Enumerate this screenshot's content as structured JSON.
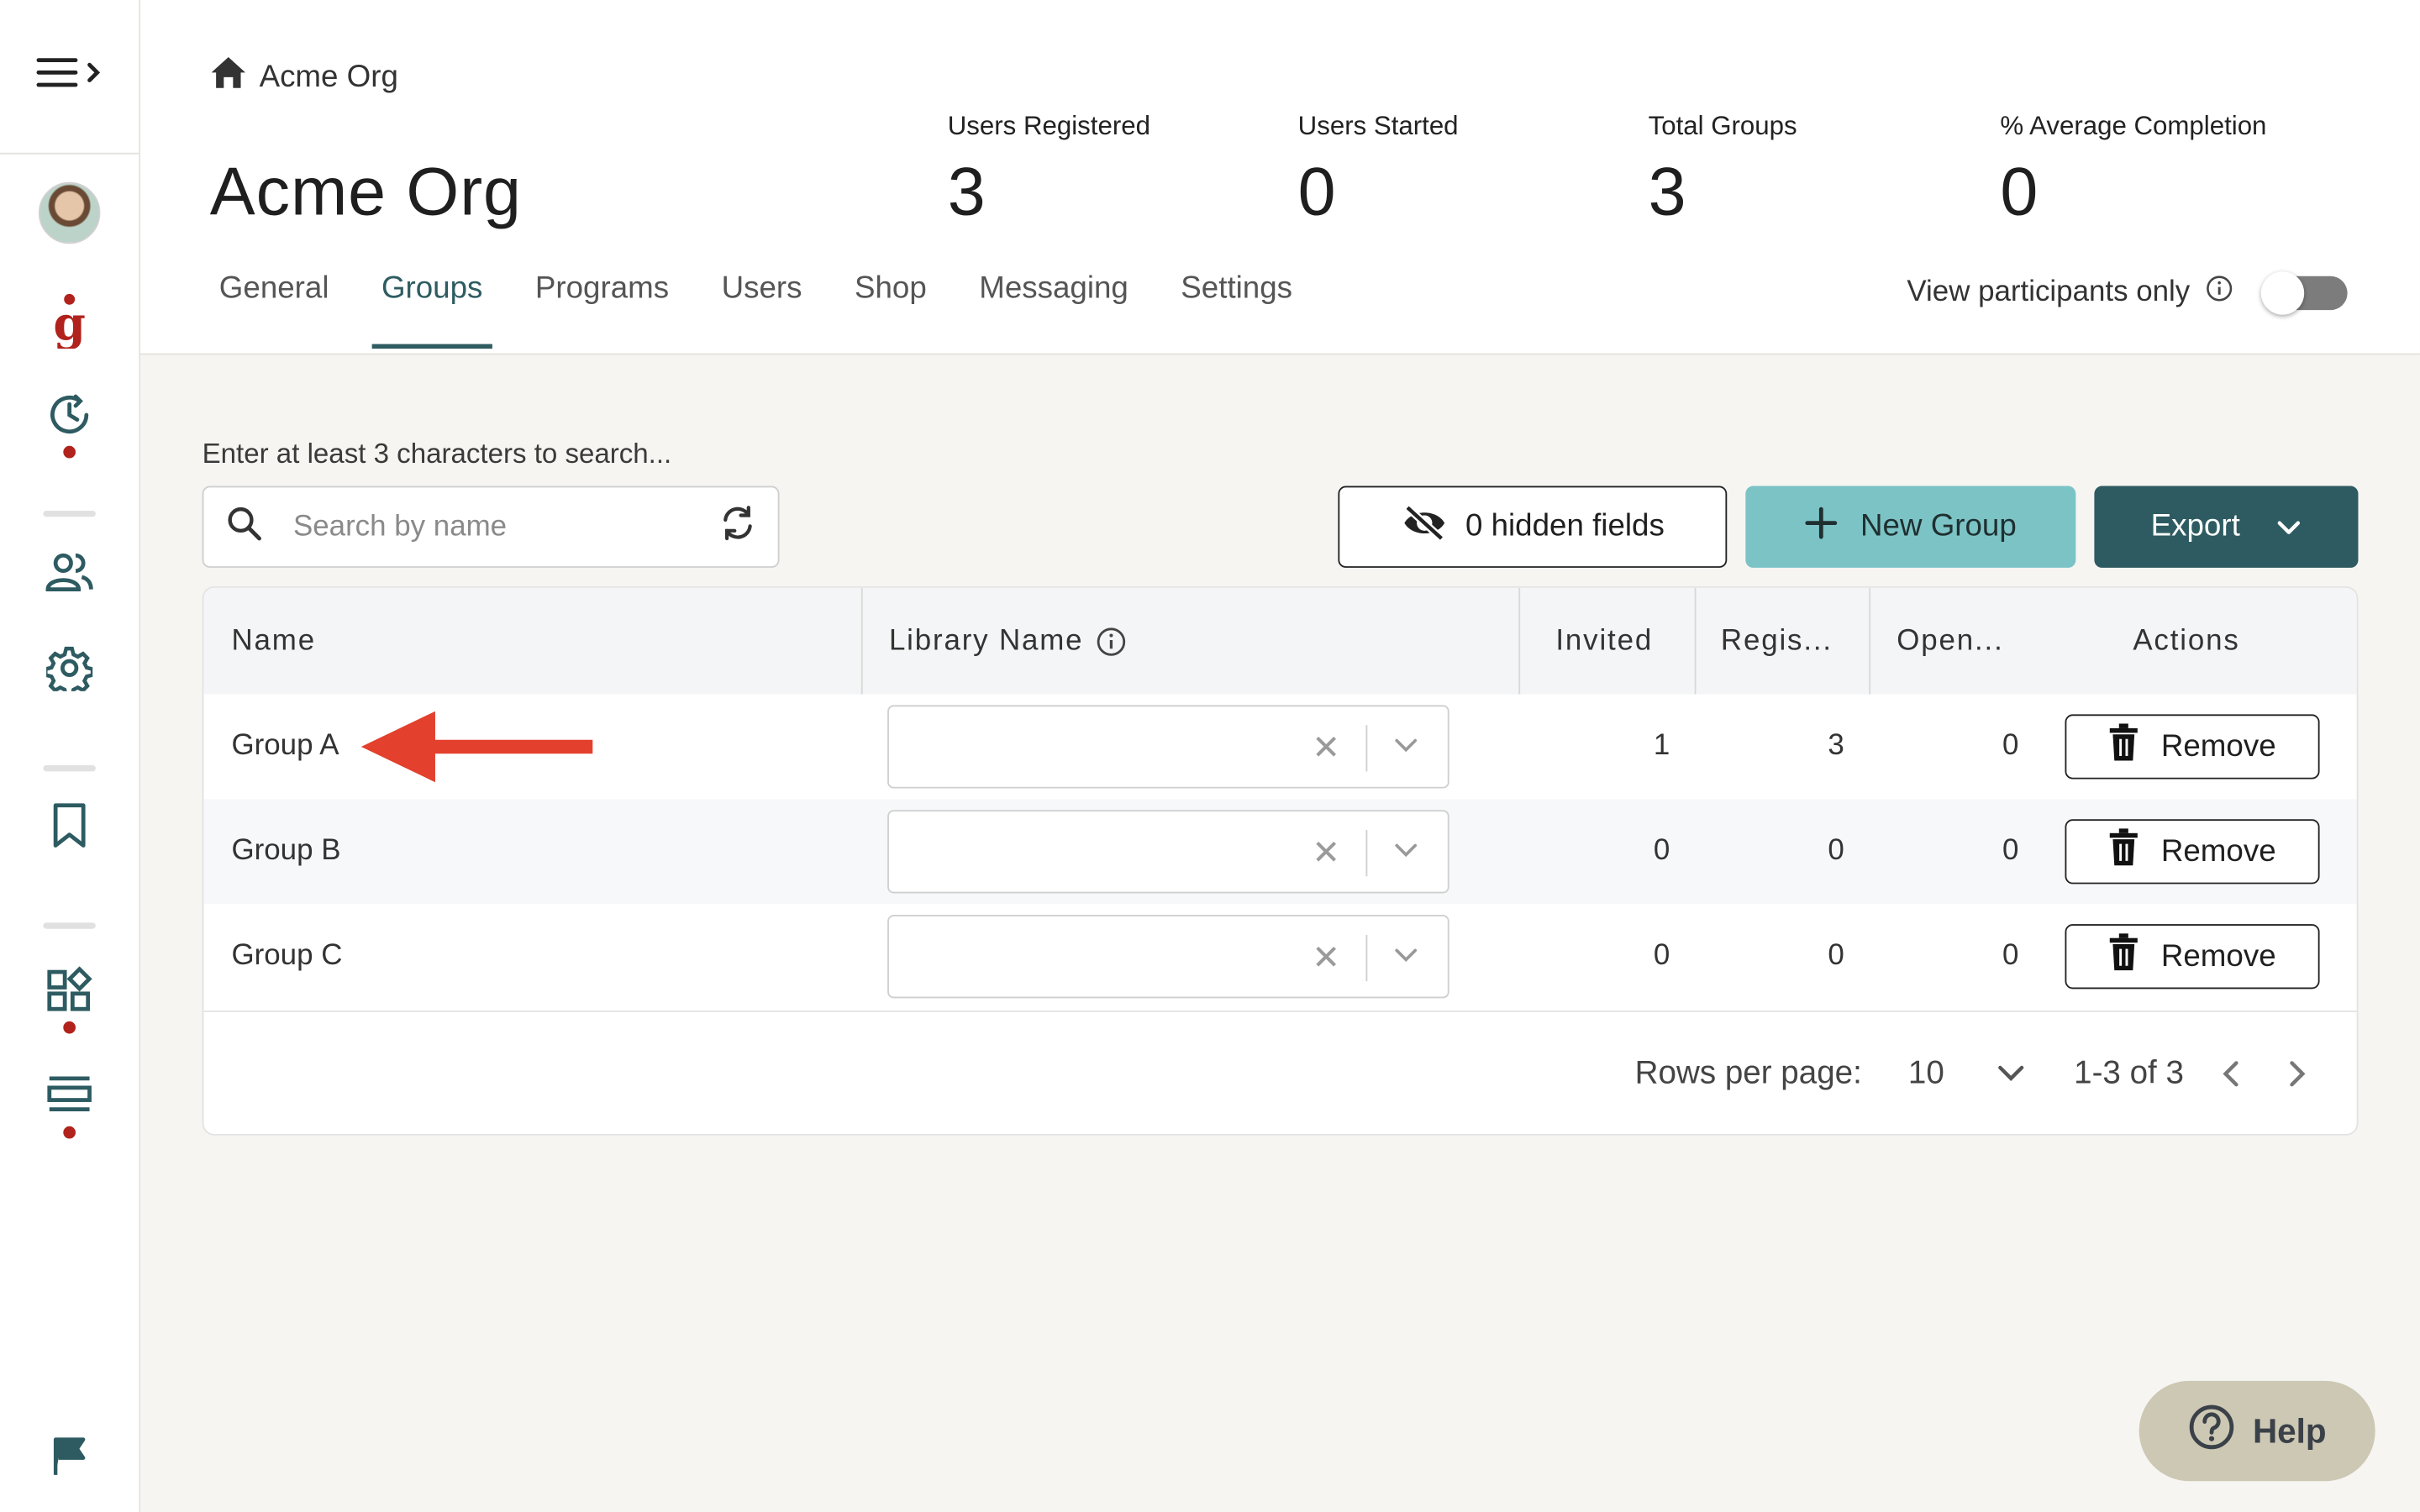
{
  "breadcrumb": {
    "home_label": "Acme Org"
  },
  "org": {
    "title": "Acme Org"
  },
  "stats": [
    {
      "label": "Users Registered",
      "value": "3"
    },
    {
      "label": "Users Started",
      "value": "0"
    },
    {
      "label": "Total Groups",
      "value": "3"
    },
    {
      "label": "% Average Completion",
      "value": "0"
    }
  ],
  "tabs": [
    {
      "label": "General"
    },
    {
      "label": "Groups",
      "active": true
    },
    {
      "label": "Programs"
    },
    {
      "label": "Users"
    },
    {
      "label": "Shop"
    },
    {
      "label": "Messaging"
    },
    {
      "label": "Settings"
    }
  ],
  "view_participants": {
    "label": "View participants only",
    "enabled": false
  },
  "search": {
    "hint": "Enter at least 3 characters to search...",
    "placeholder": "Search by name"
  },
  "toolbar": {
    "hidden_fields_label": "0 hidden fields",
    "new_group_label": "New Group",
    "export_label": "Export"
  },
  "table": {
    "columns": [
      "Name",
      "Library Name",
      "Invited",
      "Regis...",
      "Open...",
      "Actions"
    ],
    "rows": [
      {
        "name": "Group A",
        "library": "",
        "invited": "1",
        "registered": "3",
        "open": "0",
        "action": "Remove"
      },
      {
        "name": "Group B",
        "library": "",
        "invited": "0",
        "registered": "0",
        "open": "0",
        "action": "Remove"
      },
      {
        "name": "Group C",
        "library": "",
        "invited": "0",
        "registered": "0",
        "open": "0",
        "action": "Remove"
      }
    ]
  },
  "pagination": {
    "rows_per_page_label": "Rows per page:",
    "rows_per_page": "10",
    "range": "1-3 of 3"
  },
  "help": {
    "label": "Help"
  },
  "colors": {
    "accent": "#2d5b61",
    "new_button": "#7cc3c6",
    "brand_red": "#b1221d",
    "annotation_arrow": "#e3402d",
    "help_bg": "#cdc8b4"
  }
}
